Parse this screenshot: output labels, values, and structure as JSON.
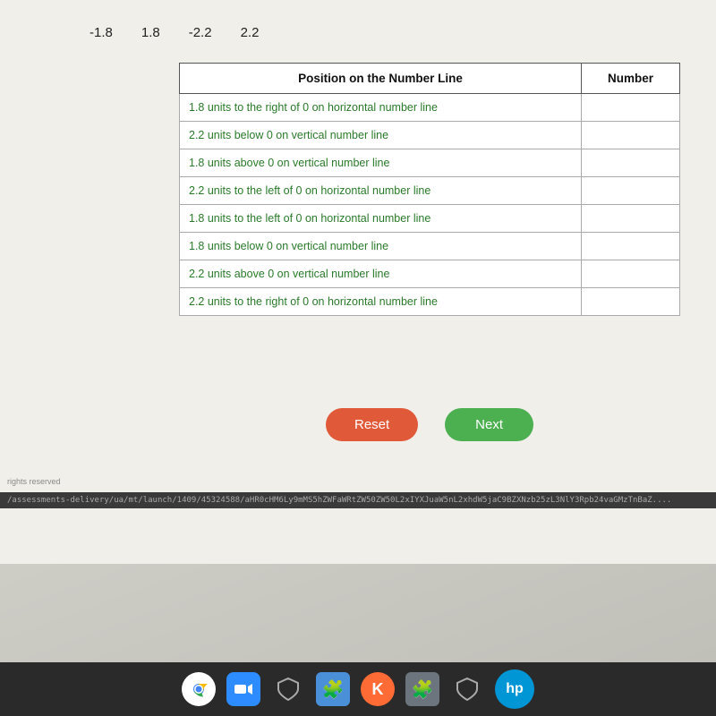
{
  "page": {
    "background_color": "#f0efea"
  },
  "number_labels": [
    "-1.8",
    "1.8",
    "-2.2",
    "2.2"
  ],
  "table": {
    "headers": [
      "Position on the Number Line",
      "Number"
    ],
    "rows": [
      {
        "position": "1.8 units to the right of 0 on horizontal number line",
        "number": ""
      },
      {
        "position": "2.2 units below 0 on vertical number line",
        "number": ""
      },
      {
        "position": "1.8 units above 0 on vertical number line",
        "number": ""
      },
      {
        "position": "2.2 units to the left of 0 on horizontal number line",
        "number": ""
      },
      {
        "position": "1.8 units to the left of 0 on horizontal number line",
        "number": ""
      },
      {
        "position": "1.8 units below 0 on vertical number line",
        "number": ""
      },
      {
        "position": "2.2 units above 0 on vertical number line",
        "number": ""
      },
      {
        "position": "2.2 units to the right of 0 on horizontal number line",
        "number": ""
      }
    ]
  },
  "buttons": {
    "reset_label": "Reset",
    "next_label": "Next"
  },
  "url": "/assessments-delivery/ua/mt/launch/1409/45324588/aHR0cHM6Ly9mMS5hZWFaWRtZW50ZW50L2xIYXJuaW5nL2xhdW5jaC9BZXNzb25zL3NlY3Rpb24vaGMzTnBaZ....",
  "rights_text": "rights reserved",
  "taskbar": {
    "icons": [
      "chrome",
      "zoom",
      "shield",
      "puzzle",
      "k",
      "puzzle2",
      "shield2",
      "hp"
    ]
  }
}
